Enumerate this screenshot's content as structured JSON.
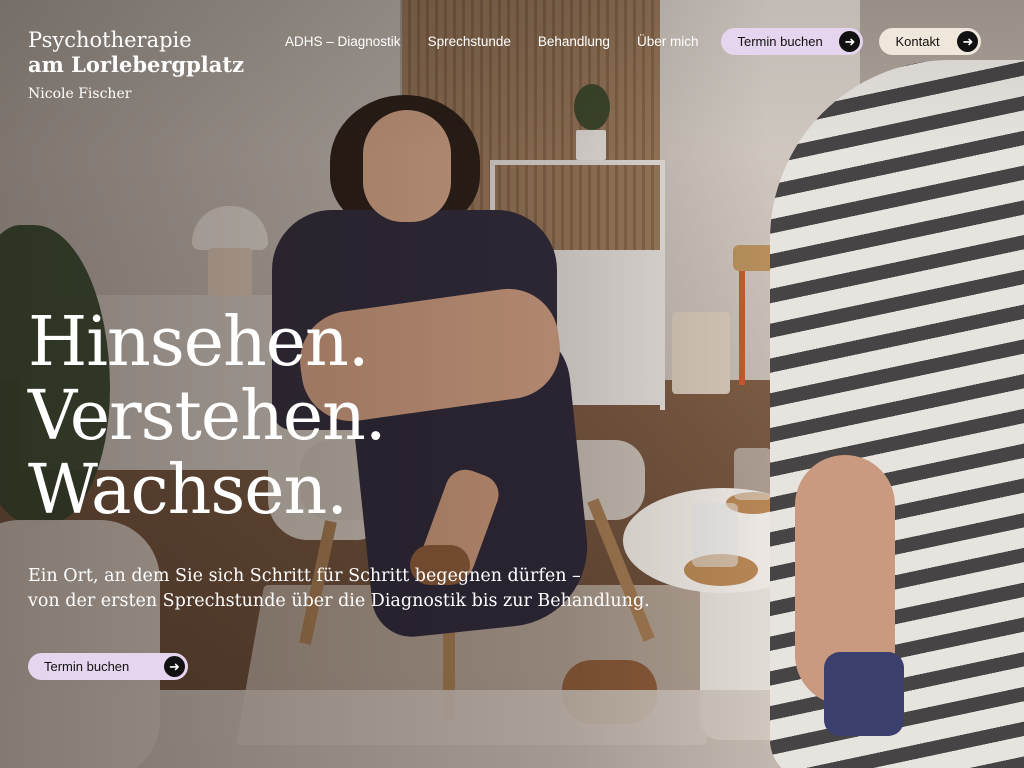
{
  "brand": {
    "line1": "Psychotherapie",
    "line2": "am Lorlebergplatz",
    "owner": "Nicole Fischer"
  },
  "nav": {
    "links": [
      "ADHS – Diagnostik",
      "Sprechstunde",
      "Behandlung",
      "Über mich"
    ],
    "termin_label": "Termin buchen",
    "kontakt_label": "Kontakt",
    "arrow_icon": "arrow-right-icon"
  },
  "hero": {
    "headline": [
      "Hinsehen.",
      "Verstehen.",
      "Wachsen."
    ],
    "lead": [
      "Ein Ort, an dem Sie sich Schritt für Schritt begegnen dürfen –",
      "von der ersten Sprechstunde über die Diagnostik bis zur Behandlung."
    ],
    "cta_label": "Termin buchen"
  },
  "colors": {
    "pill_termin": "#e6d5ee",
    "pill_kontakt": "#efe7db",
    "text": "#ffffff",
    "arrow_bg": "#111111"
  }
}
